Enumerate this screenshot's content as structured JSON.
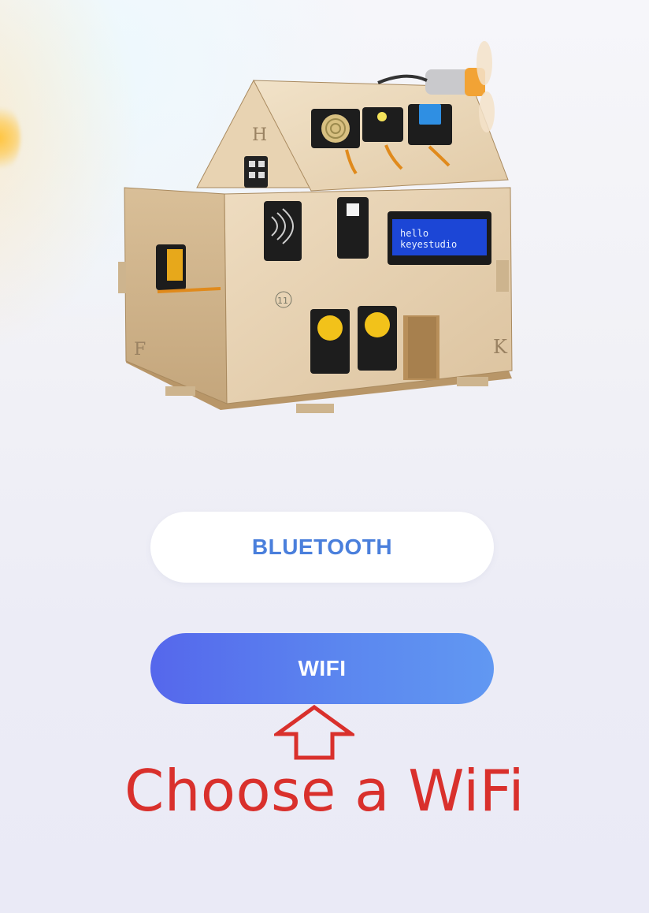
{
  "screen": {
    "hero_image_icon": "smart-home-kit-house-image",
    "lcd_line1": "hello",
    "lcd_line2": "keyestudio",
    "panel_letters": {
      "roof": "H",
      "left_wall": "F",
      "right_wall": "K",
      "label_number": "11"
    }
  },
  "buttons": {
    "bluetooth_label": "BLUETOOTH",
    "wifi_label": "WIFI"
  },
  "annotation": {
    "text": "Choose a WiFi",
    "arrow_icon": "up-arrow-outline-icon",
    "color": "#d9302c"
  },
  "colors": {
    "bluetooth_text": "#4a7fdc",
    "wifi_gradient_start": "#5567ec",
    "wifi_gradient_end": "#6198f2"
  }
}
